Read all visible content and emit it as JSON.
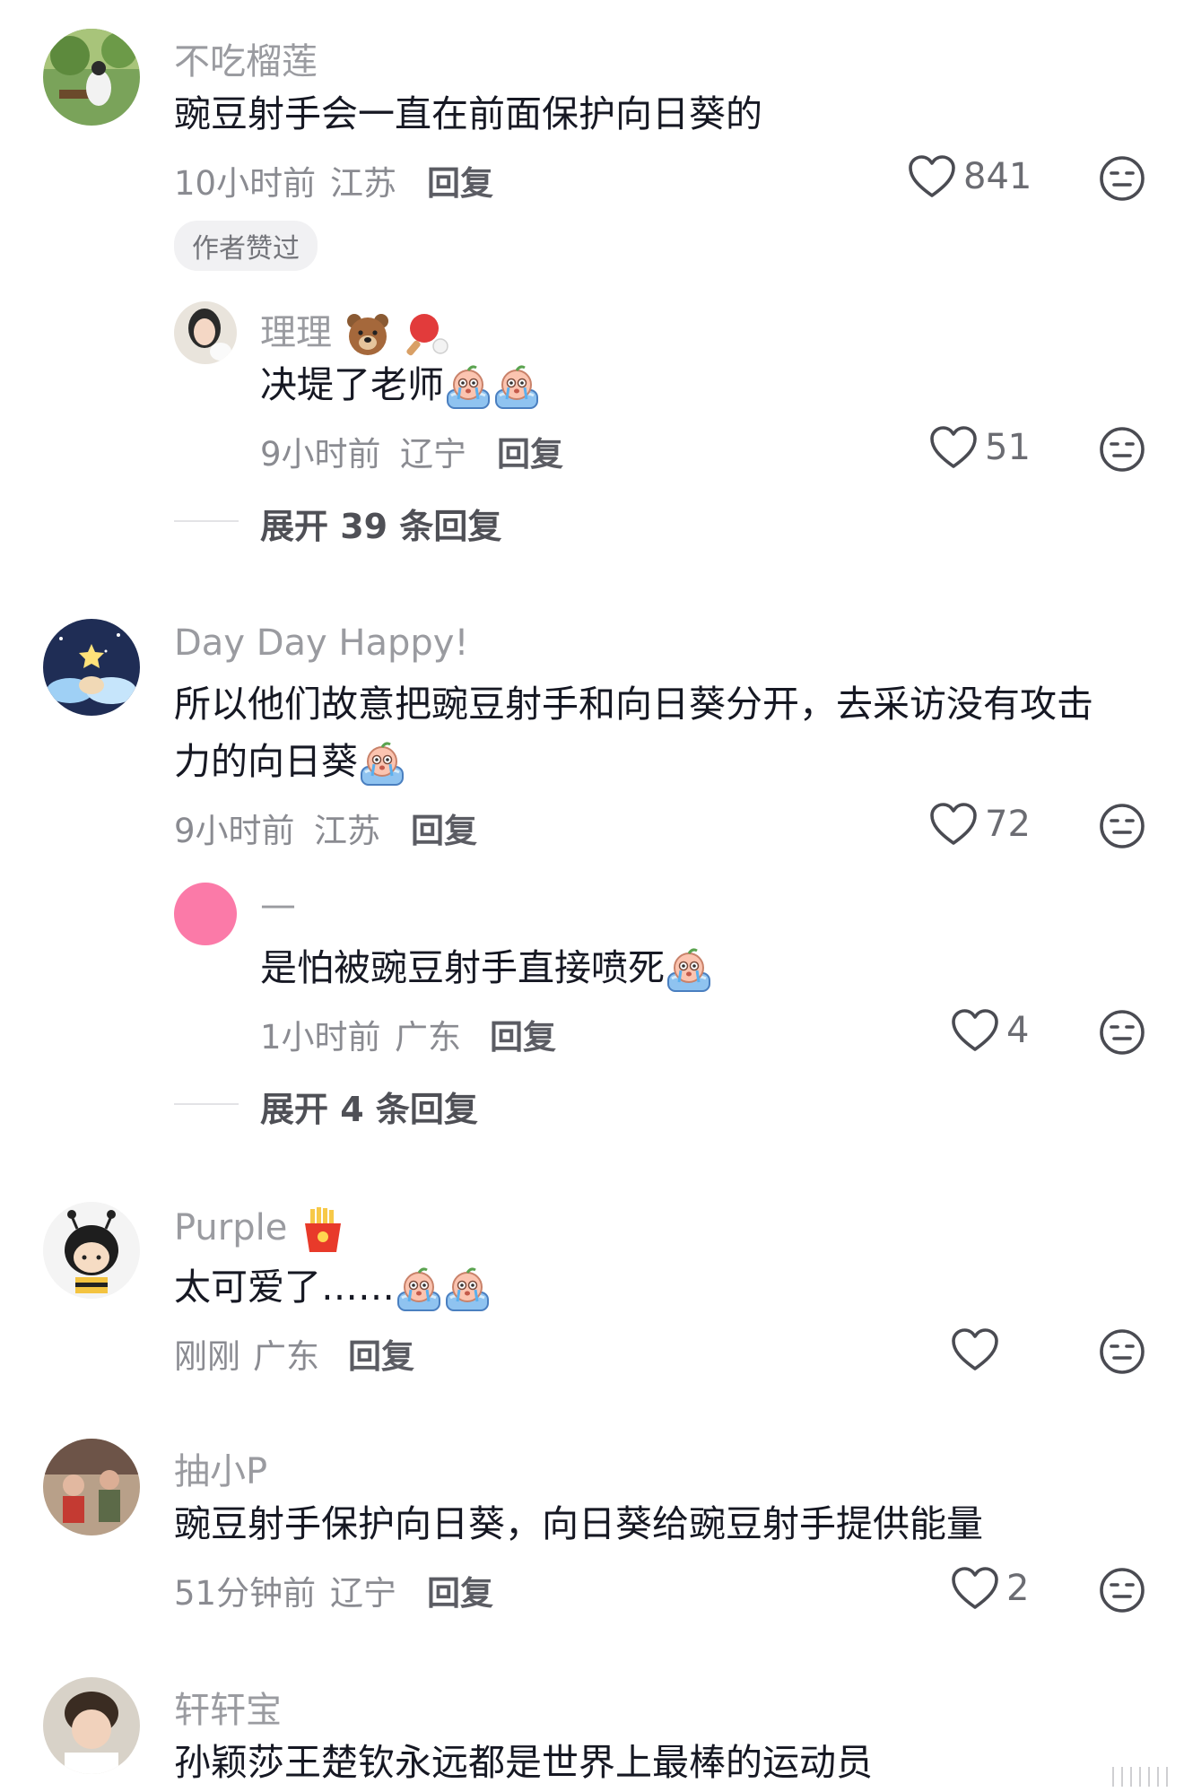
{
  "comments": [
    {
      "name": "不吃榴莲",
      "text": "豌豆射手会一直在前面保护向日葵的",
      "time": "10小时前",
      "location": "江苏",
      "reply": "回复",
      "likes": "841",
      "badge": "作者赞过",
      "replies": [
        {
          "name": "理理",
          "name_emojis": [
            "bear-emoji",
            "ping-pong-emoji"
          ],
          "text": "决堤了老师",
          "text_emojis": [
            "crying-peach-emoji",
            "crying-peach-emoji"
          ],
          "time": "9小时前",
          "location": "辽宁",
          "reply": "回复",
          "likes": "51"
        }
      ],
      "expand": "展开 39 条回复"
    },
    {
      "name": "Day Day Happy!",
      "text_line1": "所以他们故意把豌豆射手和向日葵分开，去采访没有攻击",
      "text_line2": "力的向日葵",
      "text_emojis": [
        "crying-peach-emoji"
      ],
      "time": "9小时前",
      "location": "江苏",
      "reply": "回复",
      "likes": "72",
      "replies": [
        {
          "name": "—",
          "text": "是怕被豌豆射手直接喷死",
          "text_emojis": [
            "crying-peach-emoji"
          ],
          "time": "1小时前",
          "location": "广东",
          "reply": "回复",
          "likes": "4"
        }
      ],
      "expand": "展开 4 条回复"
    },
    {
      "name": "Purple",
      "name_emojis": [
        "fries-emoji"
      ],
      "text": "太可爱了……",
      "text_emojis": [
        "crying-peach-emoji",
        "crying-peach-emoji"
      ],
      "time": "刚刚",
      "location": "广东",
      "reply": "回复",
      "likes": ""
    },
    {
      "name": "抽小P",
      "text": "豌豆射手保护向日葵，向日葵给豌豆射手提供能量",
      "time": "51分钟前",
      "location": "辽宁",
      "reply": "回复",
      "likes": "2"
    },
    {
      "name": "轩轩宝",
      "text": "孙颖莎王楚钦永远都是世界上最棒的运动员"
    }
  ],
  "icons": {
    "like": "heart-outline-icon",
    "dislike": "neutral-face-icon"
  },
  "colors": {
    "name": "#9a9ba0",
    "text": "#161823",
    "meta": "#8a8b91",
    "pink_avatar": "#fb7aa8"
  }
}
